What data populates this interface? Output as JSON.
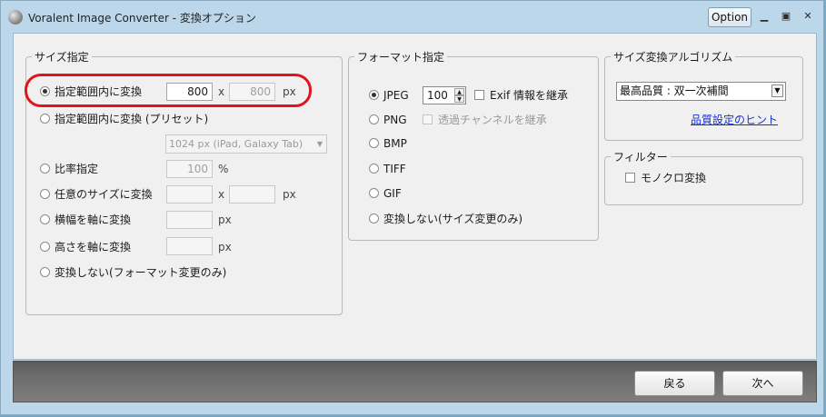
{
  "window": {
    "title": "Voralent Image Converter - 変換オプション",
    "option_label": "Option",
    "controls": [
      "minimize-icon",
      "maximize-icon",
      "close-icon"
    ]
  },
  "size_group": {
    "title": "サイズ指定",
    "options": [
      {
        "label": "指定範囲内に変換",
        "selected": true,
        "width": "800",
        "height": "800",
        "sep": "x",
        "unit": "px"
      },
      {
        "label": "指定範囲内に変換 (プリセット)",
        "selected": false,
        "preset": "1024 px (iPad, Galaxy Tab)"
      },
      {
        "label": "比率指定",
        "selected": false,
        "value": "100",
        "unit": "%"
      },
      {
        "label": "任意のサイズに変換",
        "selected": false,
        "width": "",
        "height": "",
        "sep": "x",
        "unit": "px"
      },
      {
        "label": "横幅を軸に変換",
        "selected": false,
        "value": "",
        "unit": "px"
      },
      {
        "label": "高さを軸に変換",
        "selected": false,
        "value": "",
        "unit": "px"
      },
      {
        "label": "変換しない(フォーマット変更のみ)",
        "selected": false
      }
    ]
  },
  "format_group": {
    "title": "フォーマット指定",
    "jpeg": {
      "label": "JPEG",
      "selected": true,
      "quality": "100",
      "exif_label": "Exif 情報を継承",
      "exif_checked": false
    },
    "png": {
      "label": "PNG",
      "selected": false,
      "alpha_label": "透過チャンネルを継承",
      "alpha_checked": false
    },
    "bmp": {
      "label": "BMP",
      "selected": false
    },
    "tiff": {
      "label": "TIFF",
      "selected": false
    },
    "gif": {
      "label": "GIF",
      "selected": false
    },
    "none": {
      "label": "変換しない(サイズ変更のみ)",
      "selected": false
    }
  },
  "algo_group": {
    "title": "サイズ変換アルゴリズム",
    "selected": "最高品質 : 双一次補間",
    "hint_link": "品質設定のヒント"
  },
  "filter_group": {
    "title": "フィルター",
    "mono_label": "モノクロ変換",
    "mono_checked": false
  },
  "footer": {
    "back_label": "戻る",
    "next_label": "次へ"
  },
  "colors": {
    "highlight": "#e0141a",
    "link": "#1a2fd0"
  }
}
